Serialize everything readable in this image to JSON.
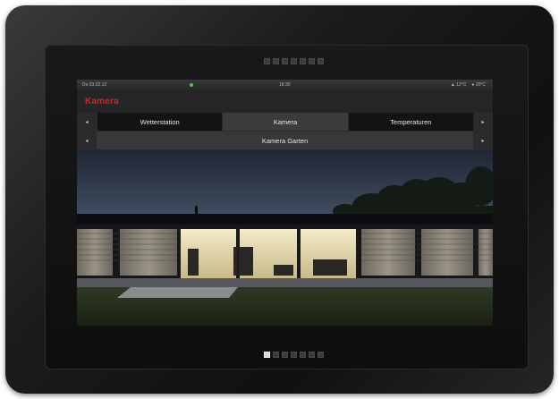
{
  "status": {
    "date": "Do 23.02.12",
    "time": "18:30",
    "indoor_temp": "12°C",
    "outdoor_temp": "20°C"
  },
  "header": {
    "title": "Kamera"
  },
  "tabs": [
    {
      "label": "Wetterstation",
      "active": false
    },
    {
      "label": "Kamera",
      "active": true
    },
    {
      "label": "Temperaturen",
      "active": false
    }
  ],
  "subtabs": {
    "current": "Kamera Garten"
  },
  "nav": {
    "prev": "◂",
    "next": "▸"
  },
  "colors": {
    "accent": "#d92128",
    "status_led": "#4ccc3a"
  },
  "pager": {
    "pages": 7,
    "current": 1
  }
}
